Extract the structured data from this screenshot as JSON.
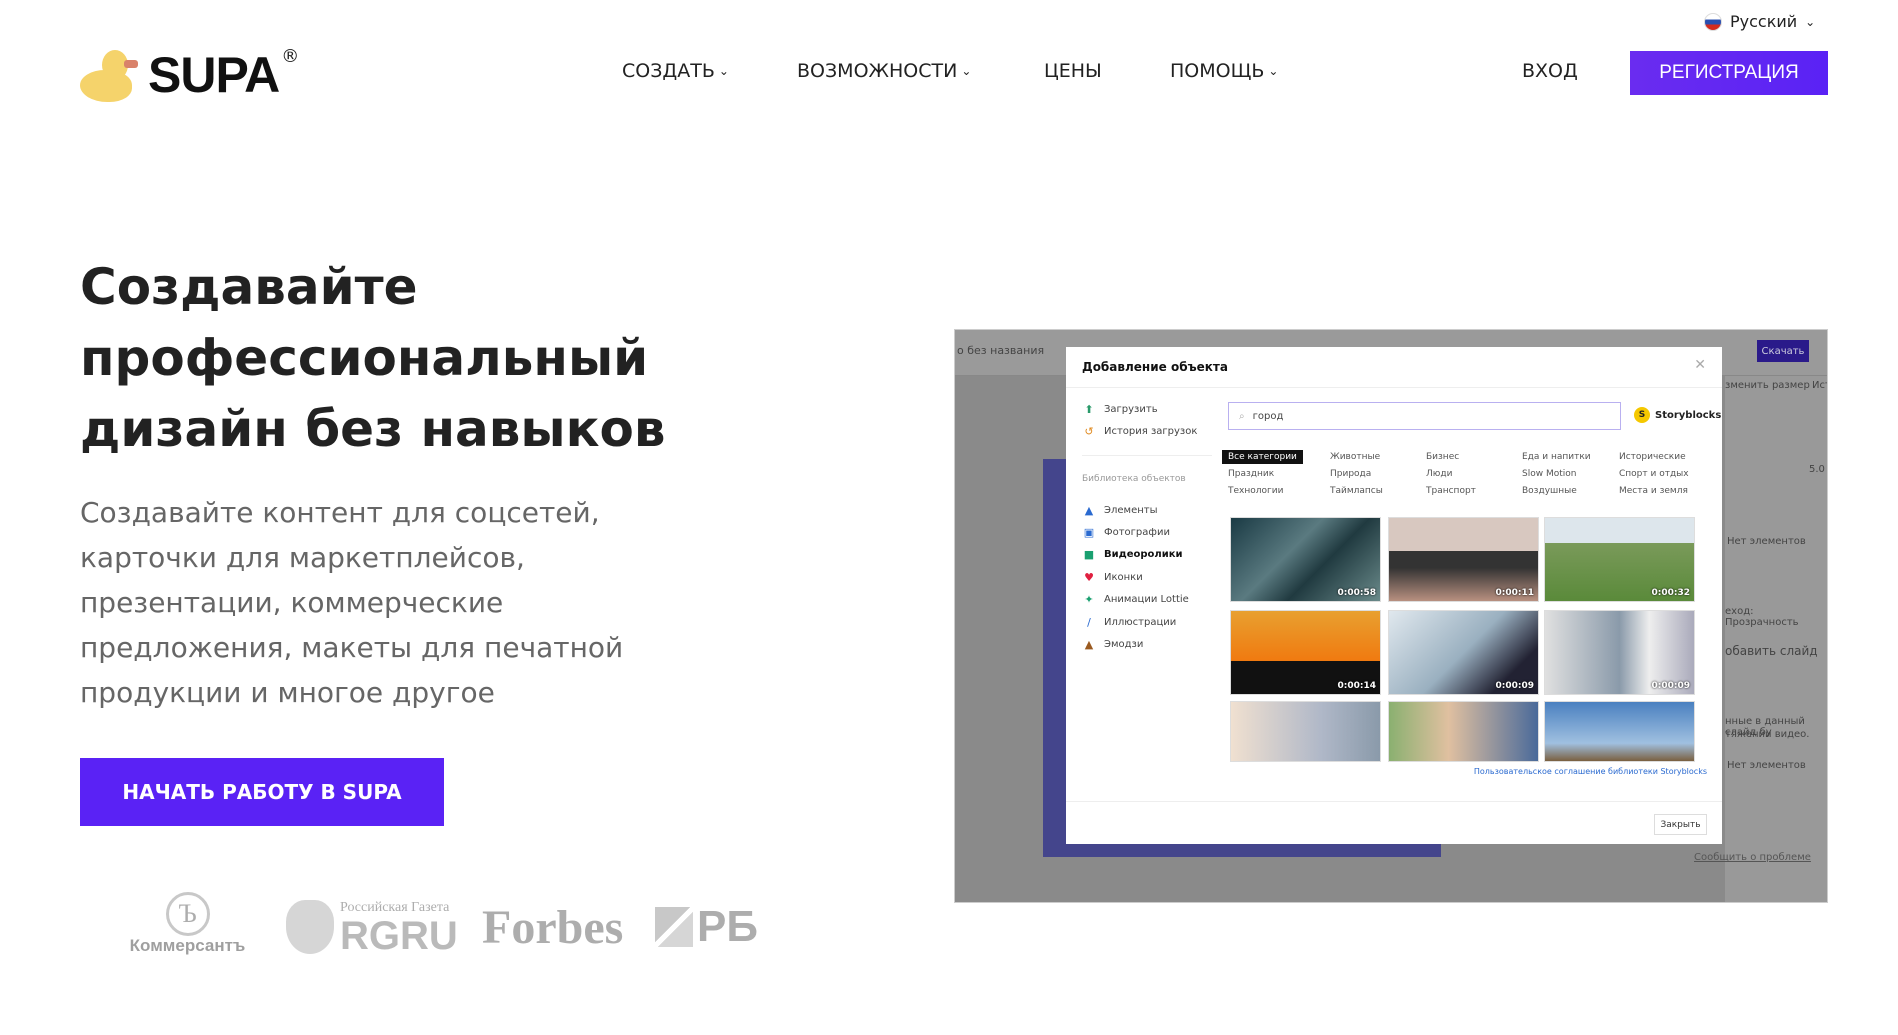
{
  "header": {
    "logo_text": "SUPA",
    "logo_mark": "®",
    "language": "Русский",
    "nav": [
      {
        "label": "СОЗДАТЬ",
        "dropdown": true
      },
      {
        "label": "ВОЗМОЖНОСТИ",
        "dropdown": true
      },
      {
        "label": "ЦЕНЫ",
        "dropdown": false
      },
      {
        "label": "ПОМОЩЬ",
        "dropdown": true
      }
    ],
    "login": "ВХОД",
    "register": "РЕГИСТРАЦИЯ",
    "accent": "#5a22f5"
  },
  "hero": {
    "title": "Создавайте профессиональный дизайн без навыков",
    "lead": "Создавайте контент для соцсетей, карточки для маркетплейсов, презентации, коммерческие предложения, макеты для печатной продукции и многое другое",
    "cta": "НАЧАТЬ РАБОТУ В SUPA"
  },
  "press": [
    "Коммерсантъ",
    "Российская Газета",
    "RGRU",
    "Forbes",
    "РБ"
  ],
  "mockup": {
    "doc_title": "о без названия",
    "download": "Скачать",
    "right_panel": [
      "зменить размер",
      "Исто",
      "5.0",
      "Нет элементов",
      "еход: Прозрачность",
      "обавить слайд",
      "нные в данный слайд бу",
      "тяжении видео.",
      "Нет элементов",
      "Сообщить о проблеме"
    ],
    "modal": {
      "title": "Добавление объекта",
      "upload": "Загрузить",
      "history": "История загрузок",
      "library_label": "Библиотека объектов",
      "library": [
        "Элементы",
        "Фотографии",
        "Видеоролики",
        "Иконки",
        "Анимации Lottie",
        "Иллюстрации",
        "Эмодзи"
      ],
      "active_library": "Видеоролики",
      "search_value": "город",
      "provider": "Storyblocks",
      "categories": [
        "Все категории",
        "Животные",
        "Бизнес",
        "Еда и напитки",
        "Исторические",
        "Праздник",
        "Природа",
        "Люди",
        "Slow Motion",
        "Спорт и отдых",
        "Технологии",
        "Таймлапсы",
        "Транспорт",
        "Воздушные",
        "Места и земля"
      ],
      "durations": [
        "0:00:58",
        "0:00:11",
        "0:00:32",
        "0:00:14",
        "0:00:09",
        "0:00:09",
        "",
        "",
        ""
      ],
      "license_link": "Пользовательское соглашение библиотеки Storyblocks",
      "close": "Закрыть"
    }
  }
}
